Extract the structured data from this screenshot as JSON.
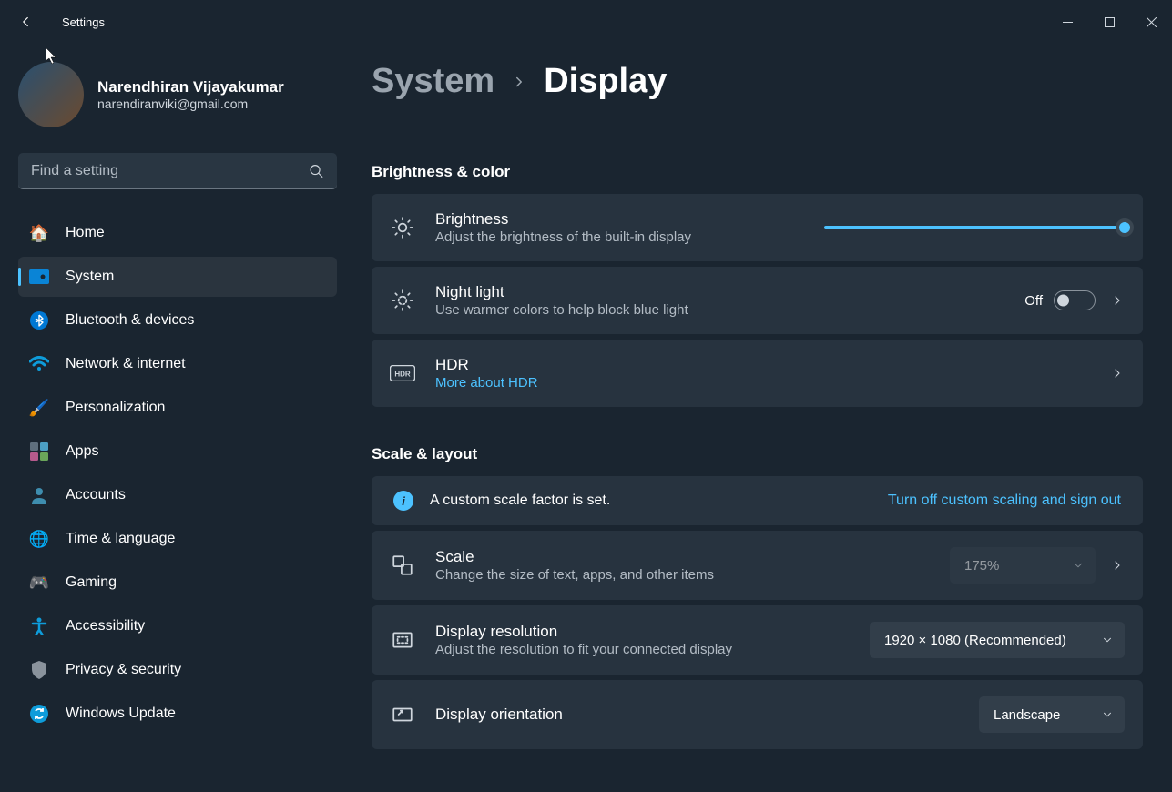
{
  "app_title": "Settings",
  "user": {
    "name": "Narendhiran Vijayakumar",
    "email": "narendiranviki@gmail.com"
  },
  "search": {
    "placeholder": "Find a setting"
  },
  "nav": {
    "items": [
      {
        "label": "Home"
      },
      {
        "label": "System"
      },
      {
        "label": "Bluetooth & devices"
      },
      {
        "label": "Network & internet"
      },
      {
        "label": "Personalization"
      },
      {
        "label": "Apps"
      },
      {
        "label": "Accounts"
      },
      {
        "label": "Time & language"
      },
      {
        "label": "Gaming"
      },
      {
        "label": "Accessibility"
      },
      {
        "label": "Privacy & security"
      },
      {
        "label": "Windows Update"
      }
    ]
  },
  "breadcrumb": {
    "parent": "System",
    "current": "Display"
  },
  "sections": {
    "brightness_color": "Brightness & color",
    "scale_layout": "Scale & layout"
  },
  "brightness": {
    "title": "Brightness",
    "sub": "Adjust the brightness of the built-in display",
    "value_percent": 100
  },
  "night_light": {
    "title": "Night light",
    "sub": "Use warmer colors to help block blue light",
    "state_label": "Off",
    "on": false
  },
  "hdr": {
    "title": "HDR",
    "link": "More about HDR"
  },
  "scale_info": {
    "text": "A custom scale factor is set.",
    "action": "Turn off custom scaling and sign out"
  },
  "scale": {
    "title": "Scale",
    "sub": "Change the size of text, apps, and other items",
    "value": "175%"
  },
  "resolution": {
    "title": "Display resolution",
    "sub": "Adjust the resolution to fit your connected display",
    "value": "1920 × 1080 (Recommended)"
  },
  "orientation": {
    "title": "Display orientation",
    "value": "Landscape"
  }
}
